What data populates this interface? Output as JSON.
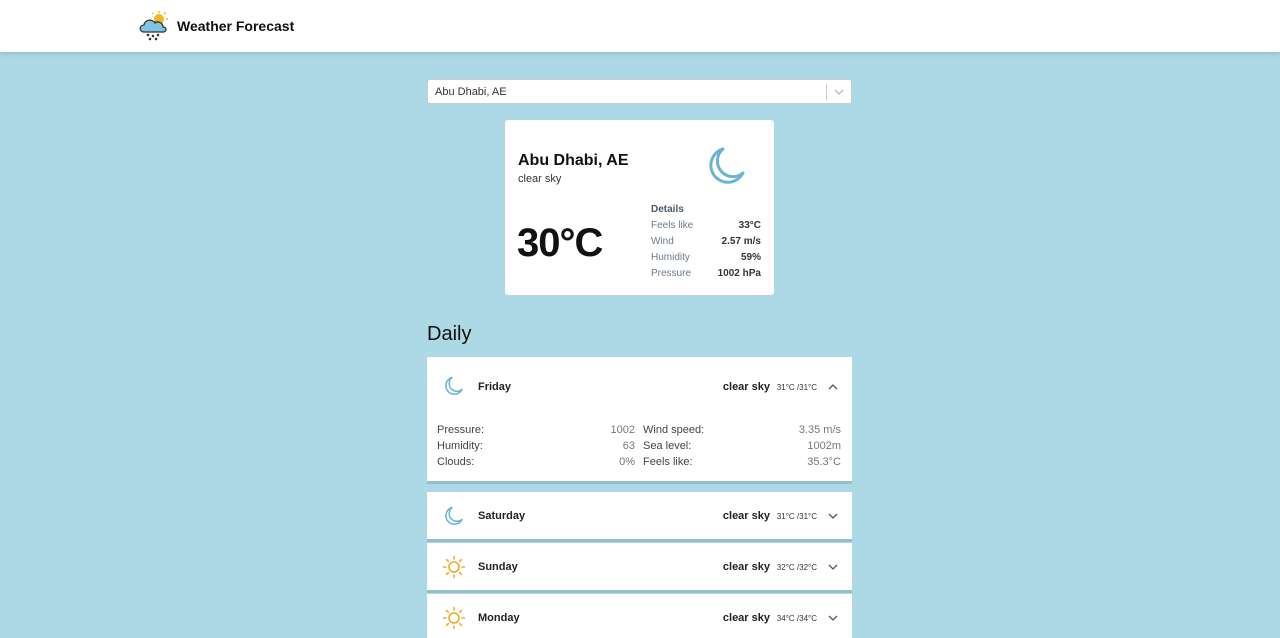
{
  "header": {
    "title": "Weather Forecast",
    "logo_icon": "cloud-snow-sun-icon"
  },
  "search": {
    "value": "Abu Dhabi, AE"
  },
  "current": {
    "city": "Abu Dhabi, AE",
    "description": "clear sky",
    "icon": "moon-icon",
    "temperature": "30°C",
    "details_title": "Details",
    "details": [
      {
        "label": "Feels like",
        "value": "33°C"
      },
      {
        "label": "Wind",
        "value": "2.57 m/s"
      },
      {
        "label": "Humidity",
        "value": "59%"
      },
      {
        "label": "Pressure",
        "value": "1002 hPa"
      }
    ]
  },
  "daily": {
    "title": "Daily",
    "days": [
      {
        "name": "Friday",
        "icon": "moon-icon",
        "description": "clear sky",
        "range": "31°C /31°C",
        "expanded": true,
        "left_details": [
          {
            "label": "Pressure:",
            "value": "1002"
          },
          {
            "label": "Humidity:",
            "value": "63"
          },
          {
            "label": "Clouds:",
            "value": "0%"
          }
        ],
        "right_details": [
          {
            "label": "Wind speed:",
            "value": "3.35 m/s"
          },
          {
            "label": "Sea level:",
            "value": "1002m"
          },
          {
            "label": "Feels like:",
            "value": "35.3°C"
          }
        ]
      },
      {
        "name": "Saturday",
        "icon": "moon-icon",
        "description": "clear sky",
        "range": "31°C /31°C",
        "expanded": false
      },
      {
        "name": "Sunday",
        "icon": "sun-icon",
        "description": "clear sky",
        "range": "32°C /32°C",
        "expanded": false
      },
      {
        "name": "Monday",
        "icon": "sun-icon",
        "description": "clear sky",
        "range": "34°C /34°C",
        "expanded": false
      }
    ]
  },
  "colors": {
    "background": "#add8e6",
    "moon": "#6ab4d4",
    "sun": "#f5a623"
  }
}
